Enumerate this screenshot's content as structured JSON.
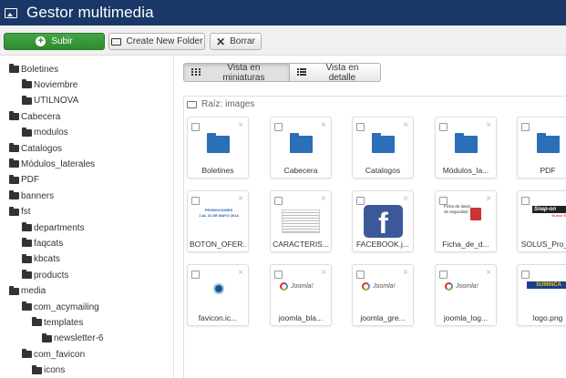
{
  "header": {
    "title": "Gestor multimedia"
  },
  "toolbar": {
    "upload_label": "Subir",
    "new_folder_label": "Create New Folder",
    "delete_label": "Borrar"
  },
  "tree": [
    {
      "label": "Boletines",
      "depth": 0
    },
    {
      "label": "Noviembre",
      "depth": 1
    },
    {
      "label": "UTILNOVA",
      "depth": 1
    },
    {
      "label": "Cabecera",
      "depth": 0
    },
    {
      "label": "modulos",
      "depth": 1
    },
    {
      "label": "Catalogos",
      "depth": 0
    },
    {
      "label": "Módulos_laterales",
      "depth": 0
    },
    {
      "label": "PDF",
      "depth": 0
    },
    {
      "label": "banners",
      "depth": 0
    },
    {
      "label": "fst",
      "depth": 0
    },
    {
      "label": "departments",
      "depth": 1
    },
    {
      "label": "faqcats",
      "depth": 1
    },
    {
      "label": "kbcats",
      "depth": 1
    },
    {
      "label": "products",
      "depth": 1
    },
    {
      "label": "media",
      "depth": 0
    },
    {
      "label": "com_acymailing",
      "depth": 1
    },
    {
      "label": "templates",
      "depth": 2
    },
    {
      "label": "newsletter-6",
      "depth": 3
    },
    {
      "label": "com_favicon",
      "depth": 1
    },
    {
      "label": "icons",
      "depth": 2
    }
  ],
  "views": {
    "thumbnails_label": "Vista en miniaturas",
    "detail_label": "Vista en detalle"
  },
  "breadcrumb": {
    "label": "Raíz: images"
  },
  "tiles": [
    {
      "label": "Boletines",
      "kind": "folder"
    },
    {
      "label": "Cabecera",
      "kind": "folder"
    },
    {
      "label": "Catalogos",
      "kind": "folder"
    },
    {
      "label": "Módulos_la...",
      "kind": "folder"
    },
    {
      "label": "PDF",
      "kind": "folder"
    },
    {
      "label": "BOTON_OFER...",
      "kind": "promo"
    },
    {
      "label": "CARACTERIS...",
      "kind": "doc"
    },
    {
      "label": "FACEBOOK.j...",
      "kind": "facebook"
    },
    {
      "label": "Ficha_de_d...",
      "kind": "ficha"
    },
    {
      "label": "SOLUS_Pro_...",
      "kind": "snapon"
    },
    {
      "label": "favicon.ic...",
      "kind": "favicon"
    },
    {
      "label": "joomla_bla...",
      "kind": "joomla"
    },
    {
      "label": "joomla_gre...",
      "kind": "joomla"
    },
    {
      "label": "joomla_log...",
      "kind": "joomla"
    },
    {
      "label": "logo.png",
      "kind": "logo"
    }
  ],
  "thumb_text": {
    "promo": [
      "PROMOCIONES",
      "1 AL 31 DE MAYO 2014"
    ],
    "ficha": [
      "Ficha de datos",
      "de seguridad"
    ],
    "facebook": "f",
    "joomla": "Joomla!",
    "snapon": [
      "Snap-on",
      "Nuevo Software"
    ],
    "logo": "SUMINCA"
  },
  "colors": {
    "title_bar": "#1a3867",
    "upload_button": "#3a9a3a",
    "folder": "#2a6fb8",
    "facebook": "#3b5998",
    "joomla_red": "#d9332b"
  }
}
